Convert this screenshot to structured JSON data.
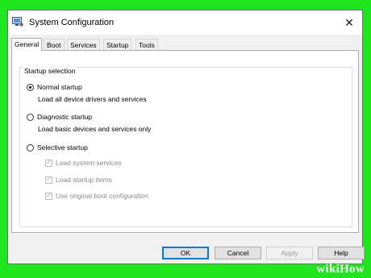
{
  "window": {
    "title": "System Configuration",
    "close_glyph": "✕",
    "icon": "system-configuration-icon"
  },
  "tabs": [
    {
      "label": "General",
      "active": true
    },
    {
      "label": "Boot",
      "active": false
    },
    {
      "label": "Services",
      "active": false
    },
    {
      "label": "Startup",
      "active": false
    },
    {
      "label": "Tools",
      "active": false
    }
  ],
  "startup_selection": {
    "group_label": "Startup selection",
    "options": [
      {
        "label": "Normal startup",
        "description": "Load all device drivers and services",
        "selected": true
      },
      {
        "label": "Diagnostic startup",
        "description": "Load basic devices and services only",
        "selected": false
      },
      {
        "label": "Selective startup",
        "selected": false
      }
    ],
    "selective_items": [
      {
        "label": "Load system services",
        "checked": true,
        "enabled": false
      },
      {
        "label": "Load startup items",
        "checked": true,
        "enabled": false
      },
      {
        "label": "Use original boot configuration",
        "checked": true,
        "enabled": false
      }
    ]
  },
  "buttons": {
    "ok": "OK",
    "cancel": "Cancel",
    "apply": "Apply",
    "help": "Help"
  },
  "watermark": "wikiHow",
  "colors": {
    "background_frame": "#1ee51e",
    "default_button_border": "#0078d7"
  }
}
